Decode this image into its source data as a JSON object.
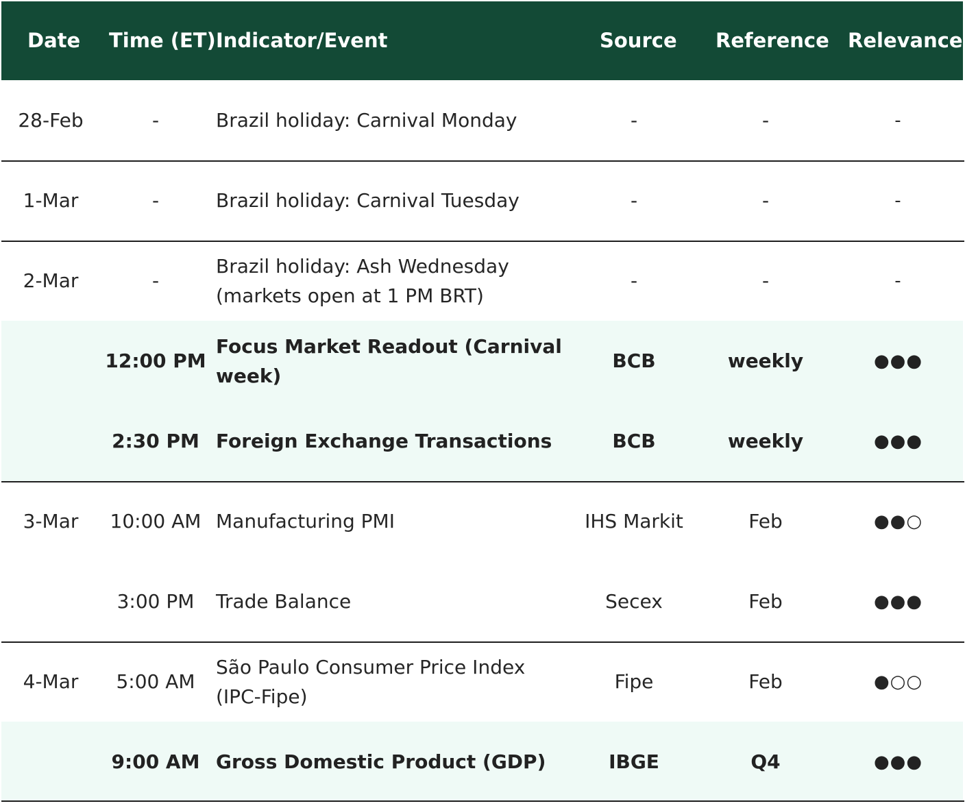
{
  "headers": {
    "date": "Date",
    "time": "Time (ET)",
    "indicator": "Indicator/Event",
    "source": "Source",
    "reference": "Reference",
    "relevance": "Relevance"
  },
  "rows": [
    {
      "date": "28-Feb",
      "time": "-",
      "indicator": "Brazil holiday: Carnival Monday",
      "source": "-",
      "reference": "-",
      "relevance": "-"
    },
    {
      "date": "1-Mar",
      "time": "-",
      "indicator": "Brazil holiday: Carnival Tuesday",
      "source": "-",
      "reference": "-",
      "relevance": "-"
    },
    {
      "date": "2-Mar",
      "time": "-",
      "indicator": "Brazil holiday: Ash Wednesday (markets open at 1 PM BRT)",
      "source": "-",
      "reference": "-",
      "relevance": "-"
    },
    {
      "date": "",
      "time": "12:00 PM",
      "indicator": "Focus Market Readout (Carnival week)",
      "source": "BCB",
      "reference": "weekly",
      "relevance": "●●●"
    },
    {
      "date": "",
      "time": "2:30 PM",
      "indicator": "Foreign Exchange Transactions",
      "source": "BCB",
      "reference": "weekly",
      "relevance": "●●●"
    },
    {
      "date": "3-Mar",
      "time": "10:00 AM",
      "indicator": "Manufacturing PMI",
      "source": "IHS Markit",
      "reference": "Feb",
      "relevance": "●●○"
    },
    {
      "date": "",
      "time": "3:00 PM",
      "indicator": "Trade Balance",
      "source": "Secex",
      "reference": "Feb",
      "relevance": "●●●"
    },
    {
      "date": "4-Mar",
      "time": "5:00 AM",
      "indicator": "São Paulo Consumer Price Index (IPC-Fipe)",
      "source": "Fipe",
      "reference": "Feb",
      "relevance": "●○○"
    },
    {
      "date": "",
      "time": "9:00 AM",
      "indicator": "Gross Domestic Product (GDP)",
      "source": "IBGE",
      "reference": "Q4",
      "relevance": "●●●"
    }
  ],
  "colors": {
    "header_bg": "#134a36",
    "highlight_bg": "#effaf6",
    "separator": "#1e1e1e"
  }
}
